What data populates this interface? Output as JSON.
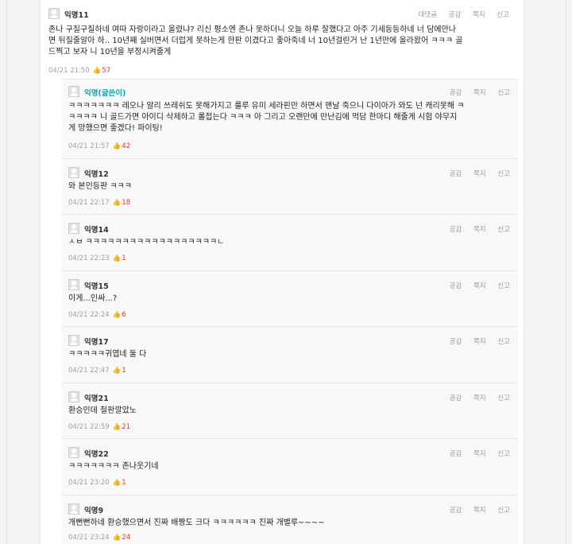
{
  "labels": {
    "reply": "대댓글",
    "like": "공감",
    "scrap": "쪽지",
    "report": "신고"
  },
  "parent": {
    "name": "익명11",
    "lines": [
      "존나 구질구질하네 여따 자랑이라고 올렸냐? 리신 평소엔 존나 못하더니 오늘 하루 잘했다고 아주 기세등등하네 너 담에만나",
      "면 뒤질줄알아 하.. 10년째 실버면서 더럽게 못하는게 한판 이겼다고 좋아죽네 너 10년걸린거 난 1년만에 올라왔어 ㅋㅋㅋ 골",
      "드찍고 보자 니 10년을 부정시켜줄게"
    ],
    "time": "04/21 21:50",
    "likes": "57"
  },
  "replies": [
    {
      "name": "익명(글쓴이)",
      "author": true,
      "lines": [
        "ㅋㅋㅋㅋㅋㅋㅋ 레오나 알리 쓰레쉬도 못해가지고 룰루 유미 세라핀만 하면서 맨날 죽으니 다이아가 와도 넌 캐리못해 ㅋ",
        "ㅋㅋㅋㅋ 니 골드가면 아이디 삭제하고 롤접는다 ㅋㅋㅋ 아 그리고 오랜만에 만난김에 먹담 한마디 해줄게 시험 야무지",
        "게 망했으면 좋겠다! 파이팅!"
      ],
      "time": "04/21 21:57",
      "likes": "42"
    },
    {
      "name": "익명12",
      "lines": [
        "와 본인등판 ㅋㅋㅋ"
      ],
      "time": "04/21 22:17",
      "likes": "18"
    },
    {
      "name": "익명14",
      "lines": [
        "ㅅㅂ ㅋㅋㅋㅋㅋㅋㅋㅋㅋㅋㅋㅋㅋㅋㅋㅋㅋㅋㄴ"
      ],
      "time": "04/21 22:23",
      "likes": "1"
    },
    {
      "name": "익명15",
      "lines": [
        "이게...인싸...?"
      ],
      "time": "04/21 22:24",
      "likes": "6"
    },
    {
      "name": "익명17",
      "lines": [
        "ㅋㅋㅋㅋㅋ귀엽네 둘 다"
      ],
      "time": "04/21 22:47",
      "likes": "1"
    },
    {
      "name": "익명21",
      "lines": [
        "환승인데 철판깔았노"
      ],
      "time": "04/21 22:59",
      "likes": "21"
    },
    {
      "name": "익명22",
      "lines": [
        "ㅋㅋㅋㅋㅋㅋㅋ 존나웃기네"
      ],
      "time": "04/21 23:20",
      "likes": "1"
    },
    {
      "name": "익명9",
      "lines": [
        "개뻔뻔하네 환승했으면서 진짜 배짱도 크다 ㅋㅋㅋㅋㅋㅋ 진짜 개별루~~~~"
      ],
      "time": "04/21 23:24",
      "likes": "24"
    }
  ],
  "colors": {
    "author": "#0ca5b0",
    "like": "#e0393e",
    "meta": "#a0a0a0"
  }
}
